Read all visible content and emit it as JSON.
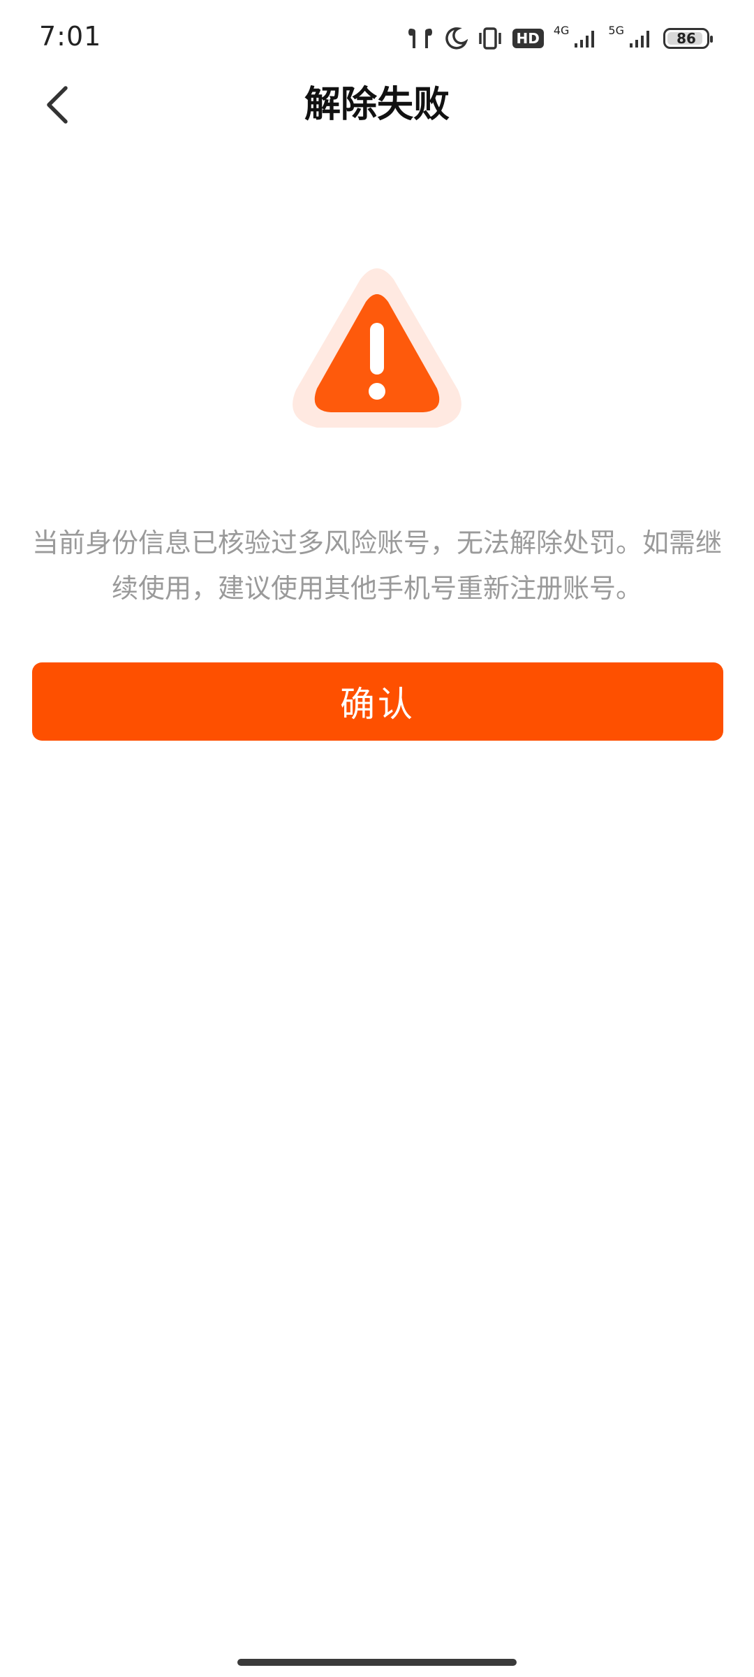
{
  "status_bar": {
    "time": "7:01",
    "hd_label": "HD",
    "network_4g": "4G",
    "network_5g": "5G",
    "battery_level": "86",
    "icons": [
      "earbuds-icon",
      "moon-icon",
      "vibrate-icon",
      "hd-icon",
      "signal-4g-icon",
      "signal-5g-icon",
      "battery-icon"
    ]
  },
  "header": {
    "back_icon": "chevron-left-icon",
    "title": "解除失败"
  },
  "main": {
    "icon": "warning-triangle-icon",
    "message": "当前身份信息已核验过多风险账号，无法解除处罚。如需继续使用，建议使用其他手机号重新注册账号。",
    "confirm_label": "确认"
  },
  "colors": {
    "accent": "#fe5000",
    "icon_halo": "#ffe9e1",
    "message_text": "#9a9a9a"
  }
}
